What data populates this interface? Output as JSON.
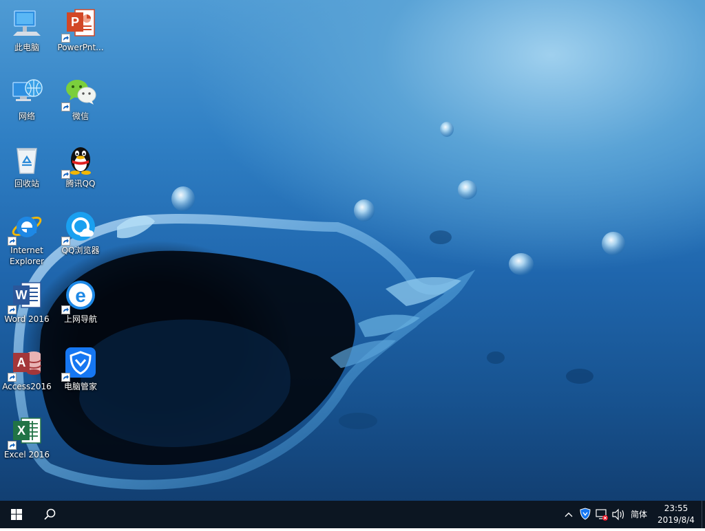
{
  "desktop": {
    "icons": [
      {
        "label": "此电脑",
        "icon": "computer-icon"
      },
      {
        "label": "PowerPnt...",
        "icon": "powerpoint-icon"
      },
      {
        "label": "网络",
        "icon": "network-icon"
      },
      {
        "label": "微信",
        "icon": "wechat-icon"
      },
      {
        "label": "回收站",
        "icon": "recycle-bin-icon"
      },
      {
        "label": "腾讯QQ",
        "icon": "qq-icon"
      },
      {
        "label": "Internet Explorer",
        "icon": "internet-explorer-icon"
      },
      {
        "label": "QQ浏览器",
        "icon": "qq-browser-icon"
      },
      {
        "label": "Word 2016",
        "icon": "word-icon"
      },
      {
        "label": "上网导航",
        "icon": "web-navigation-icon"
      },
      {
        "label": "Access2016",
        "icon": "access-icon"
      },
      {
        "label": "电脑管家",
        "icon": "pc-manager-icon"
      },
      {
        "label": "Excel 2016",
        "icon": "excel-icon"
      }
    ]
  },
  "taskbar": {
    "start_icon": "windows-logo-icon",
    "search_icon": "search-icon",
    "tray": {
      "chevron_icon": "chevron-up-icon",
      "security_icon": "pc-manager-shield-icon",
      "network_icon": "network-disconnected-icon",
      "volume_icon": "volume-icon",
      "ime_label": "简体"
    },
    "clock": {
      "time": "23:55",
      "date": "2019/8/4"
    }
  },
  "colors": {
    "taskbar_bg": "#0c1622",
    "wallpaper_primary": "#2f7fc4",
    "powerpoint": "#d24726",
    "word": "#2b579a",
    "excel": "#217346",
    "access": "#a4373a",
    "ie_blue": "#1e88e5",
    "pc_manager_blue": "#1677f2",
    "wechat_green": "#7bcf3c"
  }
}
